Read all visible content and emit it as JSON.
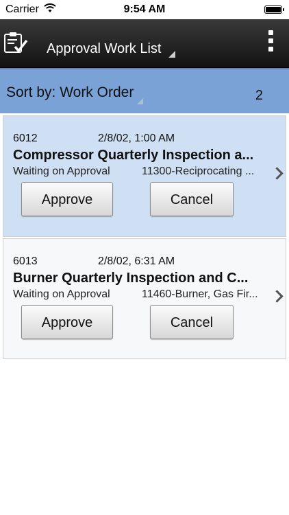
{
  "status_bar": {
    "carrier": "Carrier",
    "time": "9:54 AM"
  },
  "header": {
    "title": "Approval Work List",
    "menu_icon": "vertical-ellipsis-icon",
    "app_icon": "clipboard-check-icon"
  },
  "sort": {
    "label": "Sort by: Work Order",
    "count": "2"
  },
  "orders": [
    {
      "number": "6012",
      "date": "2/8/02, 1:00 AM",
      "title": "Compressor Quarterly Inspection a...",
      "status": "Waiting on Approval",
      "asset": "11300-Reciprocating ...",
      "approve_label": "Approve",
      "cancel_label": "Cancel",
      "selected": true
    },
    {
      "number": "6013",
      "date": "2/8/02, 6:31 AM",
      "title": "Burner Quarterly Inspection and C...",
      "status": "Waiting on Approval",
      "asset": "11460-Burner, Gas Fir...",
      "approve_label": "Approve",
      "cancel_label": "Cancel",
      "selected": false
    }
  ],
  "colors": {
    "sort_bar": "#7ba2d6",
    "selected_card": "#cfe0f5",
    "header_dark": "#121212"
  }
}
